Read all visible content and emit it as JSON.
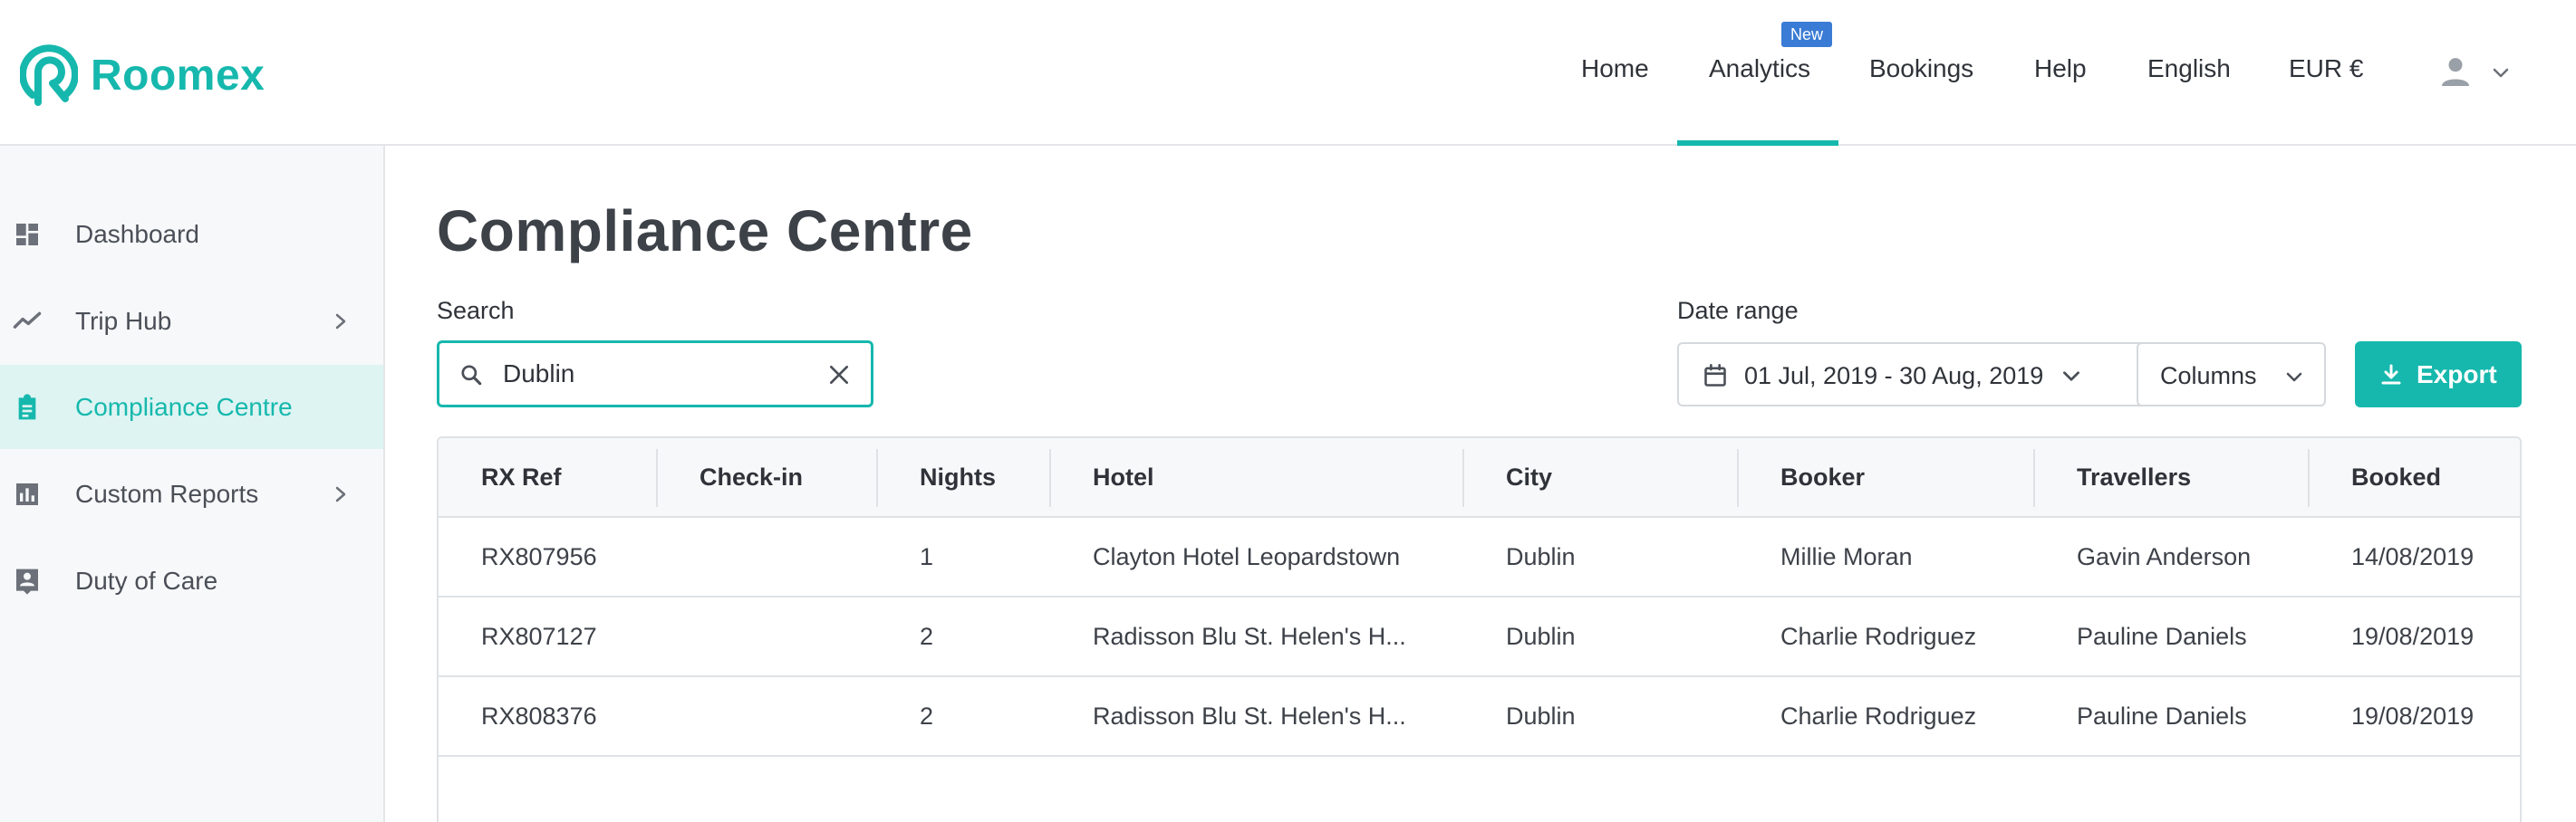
{
  "header": {
    "logo_text": "Roomex",
    "nav": {
      "home": "Home",
      "analytics": "Analytics",
      "analytics_badge": "New",
      "bookings": "Bookings",
      "help": "Help",
      "language": "English",
      "currency": "EUR €"
    },
    "user_icon": "person-icon",
    "active_nav": "Analytics",
    "accent_color": "#16b8ad"
  },
  "sidebar": {
    "items": [
      {
        "label": "Dashboard",
        "icon": "dashboard-icon",
        "has_chevron": false,
        "active": false
      },
      {
        "label": "Trip Hub",
        "icon": "trending-icon",
        "has_chevron": true,
        "active": false
      },
      {
        "label": "Compliance Centre",
        "icon": "clipboard-icon",
        "has_chevron": false,
        "active": true
      },
      {
        "label": "Custom Reports",
        "icon": "bar-chart-icon",
        "has_chevron": true,
        "active": false
      },
      {
        "label": "Duty of Care",
        "icon": "contact-card-icon",
        "has_chevron": false,
        "active": false
      }
    ]
  },
  "main": {
    "title": "Compliance Centre",
    "search": {
      "label": "Search",
      "value": "Dublin"
    },
    "date_range": {
      "label": "Date range",
      "value": "01 Jul, 2019 - 30 Aug, 2019"
    },
    "columns_label": "Columns",
    "export_label": "Export",
    "table": {
      "columns": [
        "RX Ref",
        "Check-in",
        "Nights",
        "Hotel",
        "City",
        "Booker",
        "Travellers",
        "Booked"
      ],
      "rows": [
        [
          "RX807956",
          "",
          "1",
          "Clayton Hotel Leopardstown",
          "Dublin",
          "Millie Moran",
          "Gavin Anderson",
          "14/08/2019"
        ],
        [
          "RX807127",
          "",
          "2",
          "Radisson Blu St. Helen's H...",
          "Dublin",
          "Charlie Rodriguez",
          "Pauline Daniels",
          "19/08/2019"
        ],
        [
          "RX808376",
          "",
          "2",
          "Radisson Blu St. Helen's H...",
          "Dublin",
          "Charlie Rodriguez",
          "Pauline Daniels",
          "19/08/2019"
        ]
      ]
    }
  }
}
